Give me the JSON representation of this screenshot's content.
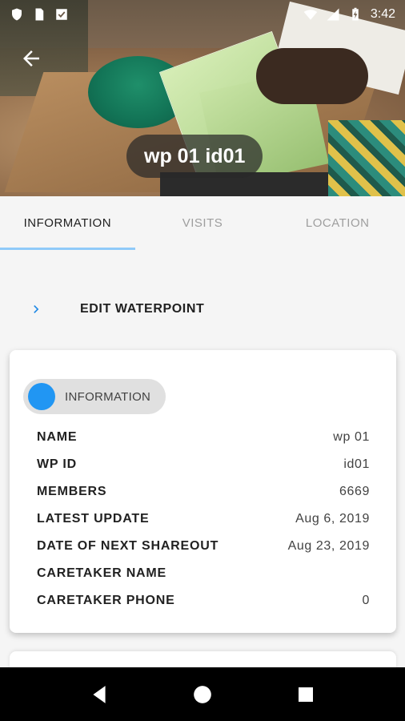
{
  "status_bar": {
    "time": "3:42",
    "icons": [
      "shield-icon",
      "sim-card-icon",
      "check-box-icon",
      "wifi-icon",
      "signal-icon",
      "battery-charging-icon"
    ]
  },
  "header": {
    "title": "wp 01 id01",
    "back_icon": "arrow-back-icon"
  },
  "tabs": [
    {
      "label": "INFORMATION",
      "active": true
    },
    {
      "label": "VISITS",
      "active": false
    },
    {
      "label": "LOCATION",
      "active": false
    }
  ],
  "edit_action": {
    "label": "EDIT WATERPOINT",
    "icon": "chevron-right-icon"
  },
  "info_card": {
    "chip_label": "INFORMATION",
    "rows": [
      {
        "key": "NAME",
        "value": "wp 01"
      },
      {
        "key": "WP ID",
        "value": "id01"
      },
      {
        "key": "MEMBERS",
        "value": "6669"
      },
      {
        "key": "LATEST UPDATE",
        "value": "Aug 6, 2019"
      },
      {
        "key": "DATE OF NEXT SHAREOUT",
        "value": "Aug 23, 2019"
      },
      {
        "key": "CARETAKER NAME",
        "value": ""
      },
      {
        "key": "CARETAKER PHONE",
        "value": "0"
      }
    ]
  },
  "colors": {
    "accent": "#2196f3",
    "tab_indicator": "#90caf9",
    "chevron": "#1e88e5"
  },
  "nav_bar": {
    "icons": [
      "back-triangle-icon",
      "home-circle-icon",
      "recents-square-icon"
    ]
  }
}
